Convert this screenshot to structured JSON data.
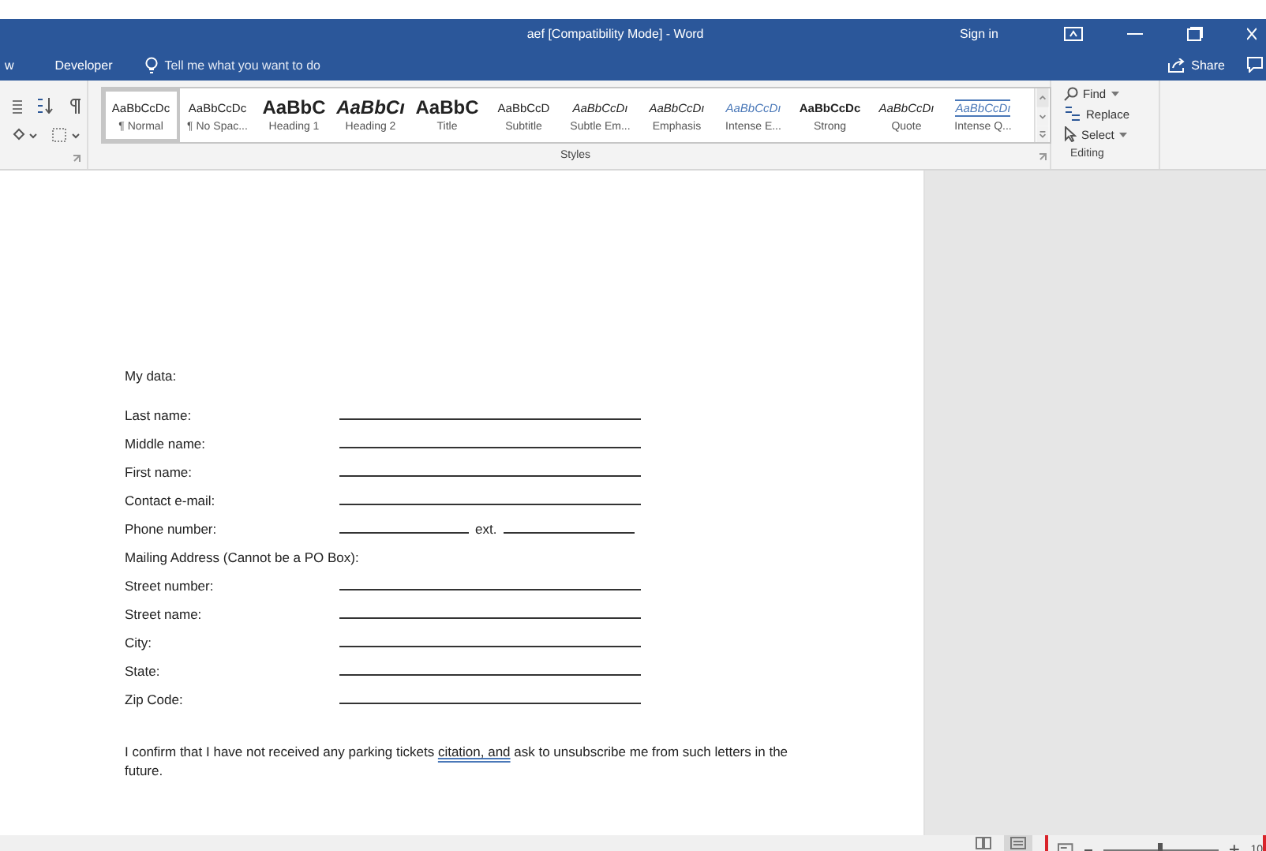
{
  "window": {
    "title": "aef [Compatibility Mode]  -  Word",
    "sign_in": "Sign in"
  },
  "menu": {
    "tabs": [
      {
        "label": "w",
        "selected": false
      },
      {
        "label": "Developer",
        "selected": false
      }
    ],
    "tell_me": "Tell me what you want to do",
    "share": "Share"
  },
  "styles_gallery": {
    "label": "Styles",
    "items": [
      {
        "preview": "AaBbCcDc",
        "name": "¶ Normal",
        "kind": "body",
        "selected": true
      },
      {
        "preview": "AaBbCcDc",
        "name": "¶ No Spac...",
        "kind": "body",
        "selected": false
      },
      {
        "preview": "AaBbC",
        "name": "Heading 1",
        "kind": "heading",
        "selected": false
      },
      {
        "preview": "AaBbCı",
        "name": "Heading 2",
        "kind": "heading-italic",
        "selected": false
      },
      {
        "preview": "AaBbC",
        "name": "Title",
        "kind": "heading",
        "selected": false
      },
      {
        "preview": "AaBbCcD",
        "name": "Subtitle",
        "kind": "body",
        "selected": false
      },
      {
        "preview": "AaBbCcDı",
        "name": "Subtle Em...",
        "kind": "italic",
        "selected": false
      },
      {
        "preview": "AaBbCcDı",
        "name": "Emphasis",
        "kind": "italic",
        "selected": false
      },
      {
        "preview": "AaBbCcDı",
        "name": "Intense E...",
        "kind": "accent",
        "selected": false
      },
      {
        "preview": "AaBbCcDc",
        "name": "Strong",
        "kind": "bold",
        "selected": false
      },
      {
        "preview": "AaBbCcDı",
        "name": "Quote",
        "kind": "italic",
        "selected": false
      },
      {
        "preview": "AaBbCcDı",
        "name": "Intense Q...",
        "kind": "accent-ruled",
        "selected": false
      }
    ]
  },
  "editing": {
    "label": "Editing",
    "buttons": [
      "Find",
      "Replace",
      "Select"
    ]
  },
  "document": {
    "heading": "My data:",
    "fields": [
      {
        "label": "Last name:",
        "kind": "line"
      },
      {
        "label": "Middle name:",
        "kind": "line"
      },
      {
        "label": "First name:",
        "kind": "line"
      },
      {
        "label": "Contact e-mail:",
        "kind": "line"
      },
      {
        "label": "Phone number:",
        "kind": "phone",
        "ext": "ext."
      },
      {
        "label": "Mailing Address (Cannot be a PO Box):",
        "kind": "heading"
      },
      {
        "label": "Street number:",
        "kind": "line"
      },
      {
        "label": "Street name:",
        "kind": "line"
      },
      {
        "label": "City:",
        "kind": "line"
      },
      {
        "label": "State:",
        "kind": "line"
      },
      {
        "label": "Zip Code:",
        "kind": "line"
      }
    ],
    "paragraph": {
      "before": "I confirm that I have not received any parking tickets ",
      "flagged": "citation, and",
      "after": " ask to unsubscribe me from such letters in the future."
    }
  },
  "status_bar": {
    "zoom": {
      "level": 0.5,
      "reading": "10"
    }
  }
}
